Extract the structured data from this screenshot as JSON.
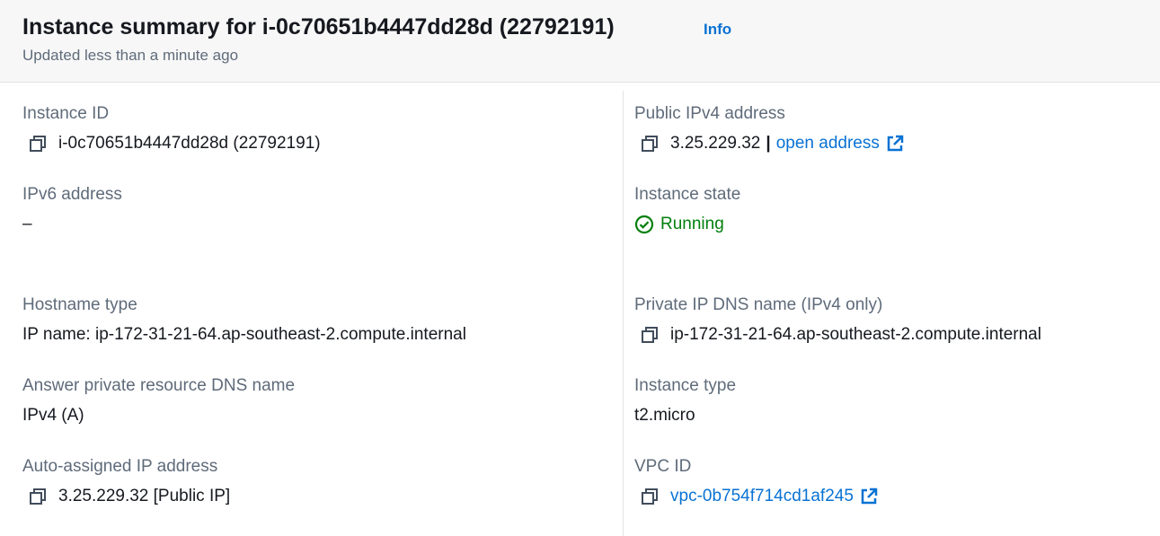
{
  "header": {
    "title": "Instance summary for i-0c70651b4447dd28d (22792191)",
    "info_label": "Info",
    "subtitle": "Updated less than a minute ago"
  },
  "left": {
    "instance_id": {
      "label": "Instance ID",
      "value": "i-0c70651b4447dd28d (22792191)"
    },
    "ipv6": {
      "label": "IPv6 address",
      "value": "–"
    },
    "hostname_type": {
      "label": "Hostname type",
      "value": "IP name: ip-172-31-21-64.ap-southeast-2.compute.internal"
    },
    "answer_dns": {
      "label": "Answer private resource DNS name",
      "value": "IPv4 (A)"
    },
    "auto_ip": {
      "label": "Auto-assigned IP address",
      "value": "3.25.229.32 [Public IP]"
    }
  },
  "right": {
    "public_ipv4": {
      "label": "Public IPv4 address",
      "value": "3.25.229.32",
      "separator": "|",
      "link_text": "open address"
    },
    "state": {
      "label": "Instance state",
      "value": "Running"
    },
    "private_dns": {
      "label": "Private IP DNS name (IPv4 only)",
      "value": "ip-172-31-21-64.ap-southeast-2.compute.internal"
    },
    "instance_type": {
      "label": "Instance type",
      "value": "t2.micro"
    },
    "vpc": {
      "label": "VPC ID",
      "value": "vpc-0b754f714cd1af245"
    }
  },
  "icons": {
    "copy": "copy-icon",
    "external": "external-link-icon",
    "status": "check-circle-icon"
  },
  "colors": {
    "link": "#0972d3",
    "success": "#037f0c",
    "label": "#5f6b7a",
    "text": "#16191f",
    "header_bg": "#f7f7f7"
  }
}
